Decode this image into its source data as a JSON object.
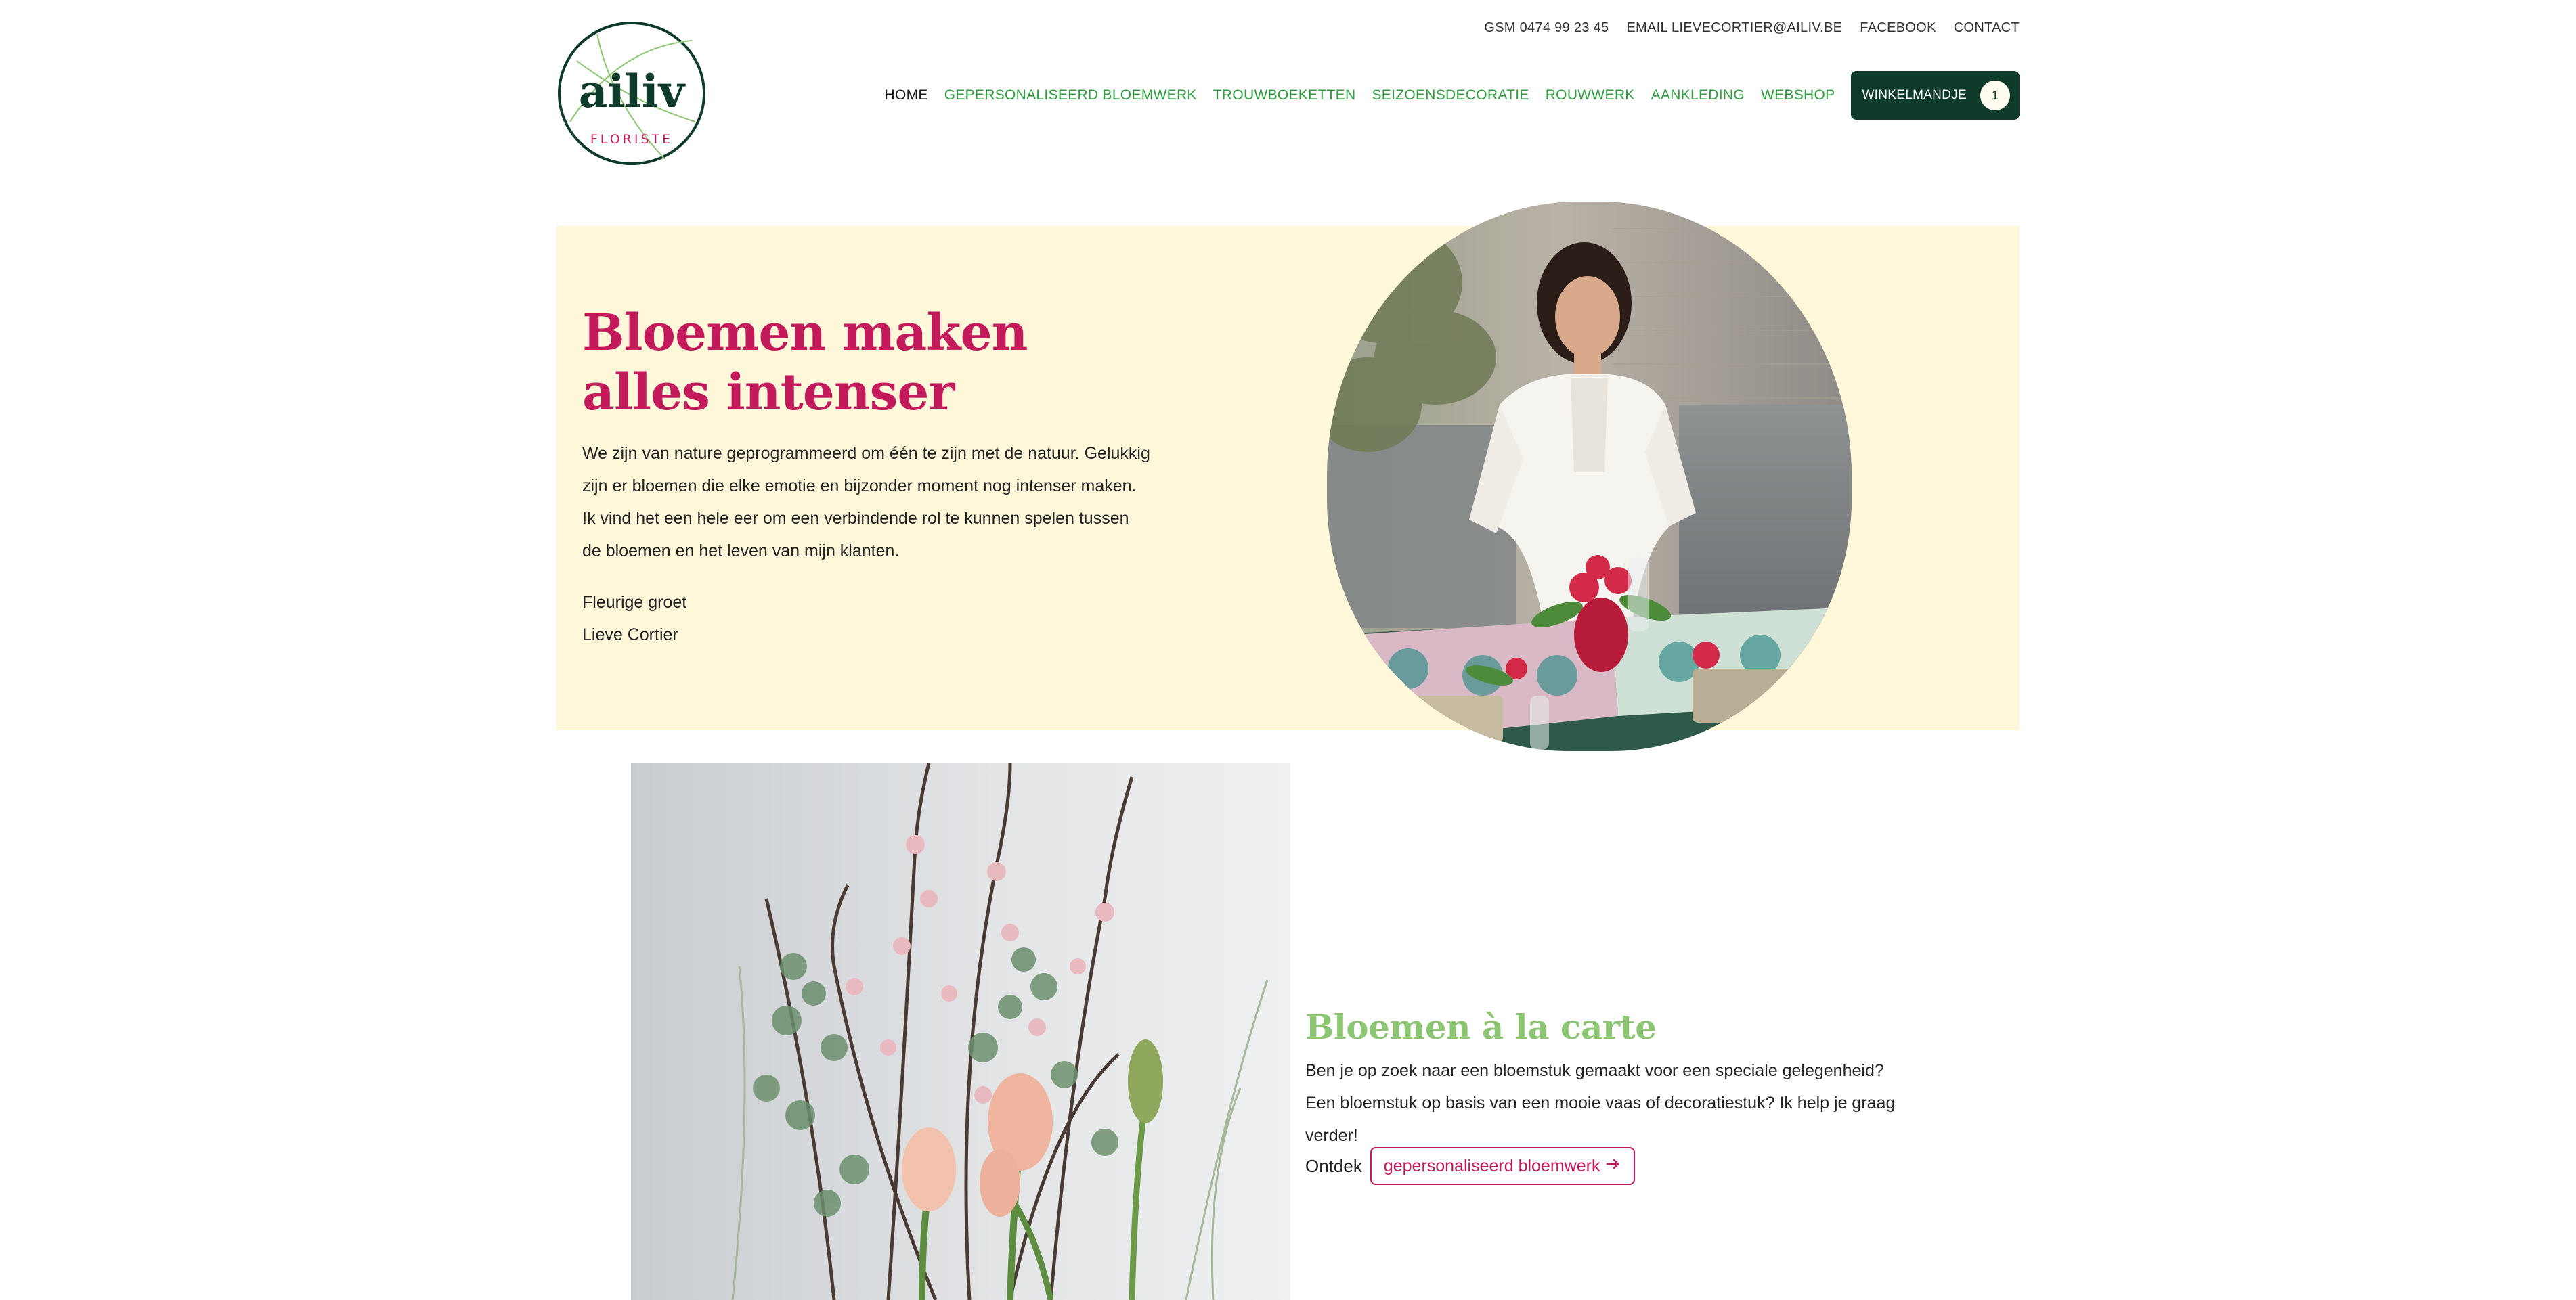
{
  "logo": {
    "word": "ailiv",
    "subtitle": "FLORISTE"
  },
  "topbar": {
    "phone": "GSM 0474 99 23 45",
    "email": "EMAIL LIEVECORTIER@AILIV.BE",
    "facebook": "FACEBOOK",
    "contact": "CONTACT"
  },
  "nav": {
    "items": [
      {
        "label": "HOME"
      },
      {
        "label": "GEPERSONALISEERD BLOEMWERK"
      },
      {
        "label": "TROUWBOEKETTEN"
      },
      {
        "label": "SEIZOENSDECORATIE"
      },
      {
        "label": "ROUWWERK"
      },
      {
        "label": "AANKLEDING"
      },
      {
        "label": "WEBSHOP"
      }
    ],
    "cart_label": "WINKELMANDJE",
    "cart_count": "1"
  },
  "hero": {
    "title": "Bloemen maken alles intenser",
    "text": "We zijn van nature geprogrammeerd om één te zijn met de natuur. Gelukkig zijn er bloemen die elke emotie en bijzonder moment nog intenser maken. Ik vind het een hele eer om een verbindende rol te kunnen spelen tussen de bloemen en het leven van mijn klanten.",
    "greeting": "Fleurige groet",
    "signature": "Lieve Cortier"
  },
  "carte": {
    "title": "Bloemen à la carte",
    "text": "Ben je op zoek naar een bloemstuk gemaakt voor een speciale gelegenheid? Een bloemstuk op basis van een mooie vaas of decoratiestuk? Ik help je graag verder!",
    "discover_label": "Ontdek",
    "button_label": "gepersonaliseerd bloemwerk"
  },
  "colors": {
    "brand_dark_green": "#0f3b2a",
    "nav_green": "#2f9e3f",
    "accent_pink": "#c21a5b",
    "light_green": "#8cc672",
    "hero_bg": "#fff7da"
  }
}
